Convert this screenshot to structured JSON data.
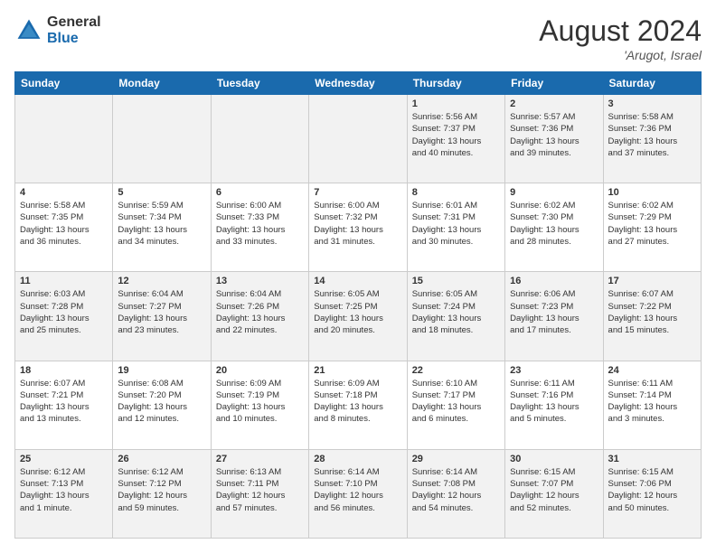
{
  "logo": {
    "general": "General",
    "blue": "Blue"
  },
  "header": {
    "month_year": "August 2024",
    "location": "'Arugot, Israel"
  },
  "weekdays": [
    "Sunday",
    "Monday",
    "Tuesday",
    "Wednesday",
    "Thursday",
    "Friday",
    "Saturday"
  ],
  "weeks": [
    [
      {
        "day": "",
        "info": ""
      },
      {
        "day": "",
        "info": ""
      },
      {
        "day": "",
        "info": ""
      },
      {
        "day": "",
        "info": ""
      },
      {
        "day": "1",
        "info": "Sunrise: 5:56 AM\nSunset: 7:37 PM\nDaylight: 13 hours\nand 40 minutes."
      },
      {
        "day": "2",
        "info": "Sunrise: 5:57 AM\nSunset: 7:36 PM\nDaylight: 13 hours\nand 39 minutes."
      },
      {
        "day": "3",
        "info": "Sunrise: 5:58 AM\nSunset: 7:36 PM\nDaylight: 13 hours\nand 37 minutes."
      }
    ],
    [
      {
        "day": "4",
        "info": "Sunrise: 5:58 AM\nSunset: 7:35 PM\nDaylight: 13 hours\nand 36 minutes."
      },
      {
        "day": "5",
        "info": "Sunrise: 5:59 AM\nSunset: 7:34 PM\nDaylight: 13 hours\nand 34 minutes."
      },
      {
        "day": "6",
        "info": "Sunrise: 6:00 AM\nSunset: 7:33 PM\nDaylight: 13 hours\nand 33 minutes."
      },
      {
        "day": "7",
        "info": "Sunrise: 6:00 AM\nSunset: 7:32 PM\nDaylight: 13 hours\nand 31 minutes."
      },
      {
        "day": "8",
        "info": "Sunrise: 6:01 AM\nSunset: 7:31 PM\nDaylight: 13 hours\nand 30 minutes."
      },
      {
        "day": "9",
        "info": "Sunrise: 6:02 AM\nSunset: 7:30 PM\nDaylight: 13 hours\nand 28 minutes."
      },
      {
        "day": "10",
        "info": "Sunrise: 6:02 AM\nSunset: 7:29 PM\nDaylight: 13 hours\nand 27 minutes."
      }
    ],
    [
      {
        "day": "11",
        "info": "Sunrise: 6:03 AM\nSunset: 7:28 PM\nDaylight: 13 hours\nand 25 minutes."
      },
      {
        "day": "12",
        "info": "Sunrise: 6:04 AM\nSunset: 7:27 PM\nDaylight: 13 hours\nand 23 minutes."
      },
      {
        "day": "13",
        "info": "Sunrise: 6:04 AM\nSunset: 7:26 PM\nDaylight: 13 hours\nand 22 minutes."
      },
      {
        "day": "14",
        "info": "Sunrise: 6:05 AM\nSunset: 7:25 PM\nDaylight: 13 hours\nand 20 minutes."
      },
      {
        "day": "15",
        "info": "Sunrise: 6:05 AM\nSunset: 7:24 PM\nDaylight: 13 hours\nand 18 minutes."
      },
      {
        "day": "16",
        "info": "Sunrise: 6:06 AM\nSunset: 7:23 PM\nDaylight: 13 hours\nand 17 minutes."
      },
      {
        "day": "17",
        "info": "Sunrise: 6:07 AM\nSunset: 7:22 PM\nDaylight: 13 hours\nand 15 minutes."
      }
    ],
    [
      {
        "day": "18",
        "info": "Sunrise: 6:07 AM\nSunset: 7:21 PM\nDaylight: 13 hours\nand 13 minutes."
      },
      {
        "day": "19",
        "info": "Sunrise: 6:08 AM\nSunset: 7:20 PM\nDaylight: 13 hours\nand 12 minutes."
      },
      {
        "day": "20",
        "info": "Sunrise: 6:09 AM\nSunset: 7:19 PM\nDaylight: 13 hours\nand 10 minutes."
      },
      {
        "day": "21",
        "info": "Sunrise: 6:09 AM\nSunset: 7:18 PM\nDaylight: 13 hours\nand 8 minutes."
      },
      {
        "day": "22",
        "info": "Sunrise: 6:10 AM\nSunset: 7:17 PM\nDaylight: 13 hours\nand 6 minutes."
      },
      {
        "day": "23",
        "info": "Sunrise: 6:11 AM\nSunset: 7:16 PM\nDaylight: 13 hours\nand 5 minutes."
      },
      {
        "day": "24",
        "info": "Sunrise: 6:11 AM\nSunset: 7:14 PM\nDaylight: 13 hours\nand 3 minutes."
      }
    ],
    [
      {
        "day": "25",
        "info": "Sunrise: 6:12 AM\nSunset: 7:13 PM\nDaylight: 13 hours\nand 1 minute."
      },
      {
        "day": "26",
        "info": "Sunrise: 6:12 AM\nSunset: 7:12 PM\nDaylight: 12 hours\nand 59 minutes."
      },
      {
        "day": "27",
        "info": "Sunrise: 6:13 AM\nSunset: 7:11 PM\nDaylight: 12 hours\nand 57 minutes."
      },
      {
        "day": "28",
        "info": "Sunrise: 6:14 AM\nSunset: 7:10 PM\nDaylight: 12 hours\nand 56 minutes."
      },
      {
        "day": "29",
        "info": "Sunrise: 6:14 AM\nSunset: 7:08 PM\nDaylight: 12 hours\nand 54 minutes."
      },
      {
        "day": "30",
        "info": "Sunrise: 6:15 AM\nSunset: 7:07 PM\nDaylight: 12 hours\nand 52 minutes."
      },
      {
        "day": "31",
        "info": "Sunrise: 6:15 AM\nSunset: 7:06 PM\nDaylight: 12 hours\nand 50 minutes."
      }
    ]
  ]
}
